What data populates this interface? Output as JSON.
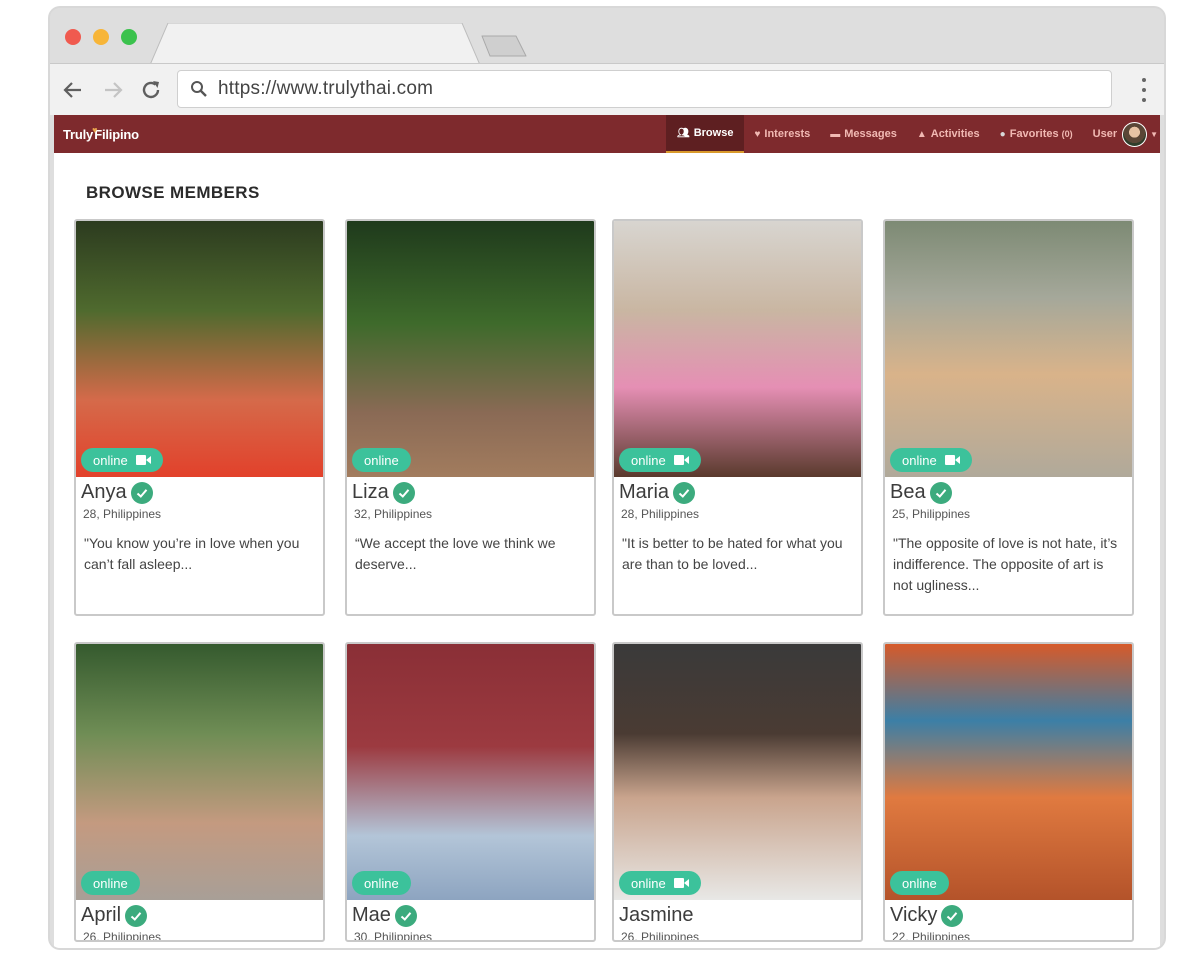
{
  "browser": {
    "url": "https://www.trulythai.com",
    "icons": {
      "back": "arrow-left-icon",
      "forward": "arrow-right-icon",
      "reload": "reload-icon",
      "search": "search-icon",
      "menu": "kebab-menu-icon"
    }
  },
  "site": {
    "logo_left": "Truly",
    "logo_right": "Filipino",
    "brand_color": "#7e2a2d",
    "accent_color": "#3cc29b",
    "nav": [
      {
        "label": "Browse",
        "icon": "users-icon",
        "active": true
      },
      {
        "label": "Interests",
        "icon": "heart-icon",
        "active": false
      },
      {
        "label": "Messages",
        "icon": "chat-icon",
        "active": false
      },
      {
        "label": "Activities",
        "icon": "bell-icon",
        "active": false
      },
      {
        "label": "Favorites",
        "icon": "dot-icon",
        "count": "(0)",
        "active": false
      }
    ],
    "user_label": "User"
  },
  "page": {
    "title": "BROWSE MEMBERS"
  },
  "members": [
    {
      "name": "Anya",
      "meta": "28, Philippines",
      "status": "online",
      "video": true,
      "verified": true,
      "quote": "\"You know you’re in love when you can’t fall asleep..."
    },
    {
      "name": "Liza",
      "meta": "32, Philippines",
      "status": "online",
      "video": false,
      "verified": true,
      "quote": "“We accept the love we think we deserve..."
    },
    {
      "name": "Maria",
      "meta": "28, Philippines",
      "status": "online",
      "video": true,
      "verified": true,
      "quote": "\"It is better to be hated for what you are than to be loved..."
    },
    {
      "name": "Bea",
      "meta": "25, Philippines",
      "status": "online",
      "video": true,
      "verified": true,
      "quote": "\"The opposite of love is not hate, it’s indifference. The opposite of art is not ugliness..."
    },
    {
      "name": "April",
      "meta": "26, Philippines",
      "status": "online",
      "video": false,
      "verified": true,
      "quote": ""
    },
    {
      "name": "Mae",
      "meta": "30, Philippines",
      "status": "online",
      "video": false,
      "verified": true,
      "quote": ""
    },
    {
      "name": "Jasmine",
      "meta": "26, Philippines",
      "status": "online",
      "video": true,
      "verified": false,
      "quote": ""
    },
    {
      "name": "Vicky",
      "meta": "22, Philippines",
      "status": "online",
      "video": false,
      "verified": true,
      "quote": ""
    }
  ]
}
